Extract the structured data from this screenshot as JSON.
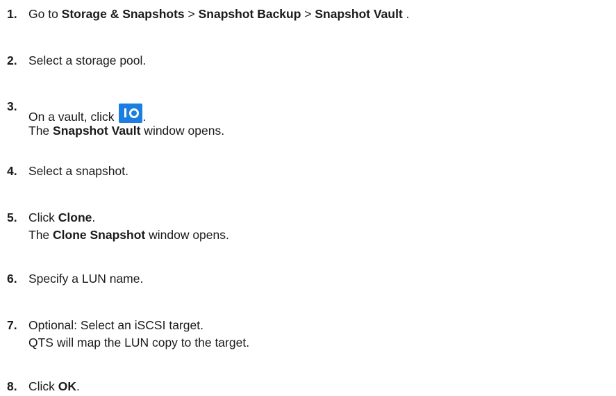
{
  "steps": [
    {
      "number": "1.",
      "lines": [
        [
          {
            "text": "Go to ",
            "bold": false
          },
          {
            "text": "Storage & Snapshots",
            "bold": true
          },
          {
            "text": " > ",
            "bold": false
          },
          {
            "text": "Snapshot Backup",
            "bold": true
          },
          {
            "text": " > ",
            "bold": false
          },
          {
            "text": "Snapshot Vault",
            "bold": true
          },
          {
            "text": " .",
            "bold": false
          }
        ]
      ]
    },
    {
      "number": "2.",
      "lines": [
        [
          {
            "text": "Select a storage pool.",
            "bold": false
          }
        ]
      ]
    },
    {
      "number": "3.",
      "lines": [
        [
          {
            "text": "On a vault, click ",
            "bold": false
          },
          {
            "icon": "vault-snapshot-icon"
          },
          {
            "text": ".",
            "bold": false
          }
        ],
        [
          {
            "text": "The ",
            "bold": false
          },
          {
            "text": "Snapshot Vault",
            "bold": true
          },
          {
            "text": " window opens.",
            "bold": false
          }
        ]
      ]
    },
    {
      "number": "4.",
      "lines": [
        [
          {
            "text": "Select a snapshot.",
            "bold": false
          }
        ]
      ]
    },
    {
      "number": "5.",
      "lines": [
        [
          {
            "text": "Click ",
            "bold": false
          },
          {
            "text": "Clone",
            "bold": true
          },
          {
            "text": ".",
            "bold": false
          }
        ],
        [
          {
            "text": "The ",
            "bold": false
          },
          {
            "text": "Clone Snapshot",
            "bold": true
          },
          {
            "text": " window opens.",
            "bold": false
          }
        ]
      ]
    },
    {
      "number": "6.",
      "lines": [
        [
          {
            "text": "Specify a LUN name.",
            "bold": false
          }
        ]
      ]
    },
    {
      "number": "7.",
      "lines": [
        [
          {
            "text": "Optional: Select an iSCSI target.",
            "bold": false
          }
        ],
        [
          {
            "text": "QTS will map the LUN copy to the target.",
            "bold": false
          }
        ]
      ]
    },
    {
      "number": "8.",
      "lines": [
        [
          {
            "text": "Click ",
            "bold": false
          },
          {
            "text": "OK",
            "bold": true
          },
          {
            "text": ".",
            "bold": false
          }
        ]
      ]
    }
  ],
  "colors": {
    "text": "#1a1a1a",
    "icon_background": "#1a7fe0",
    "icon_foreground": "#ffffff"
  }
}
